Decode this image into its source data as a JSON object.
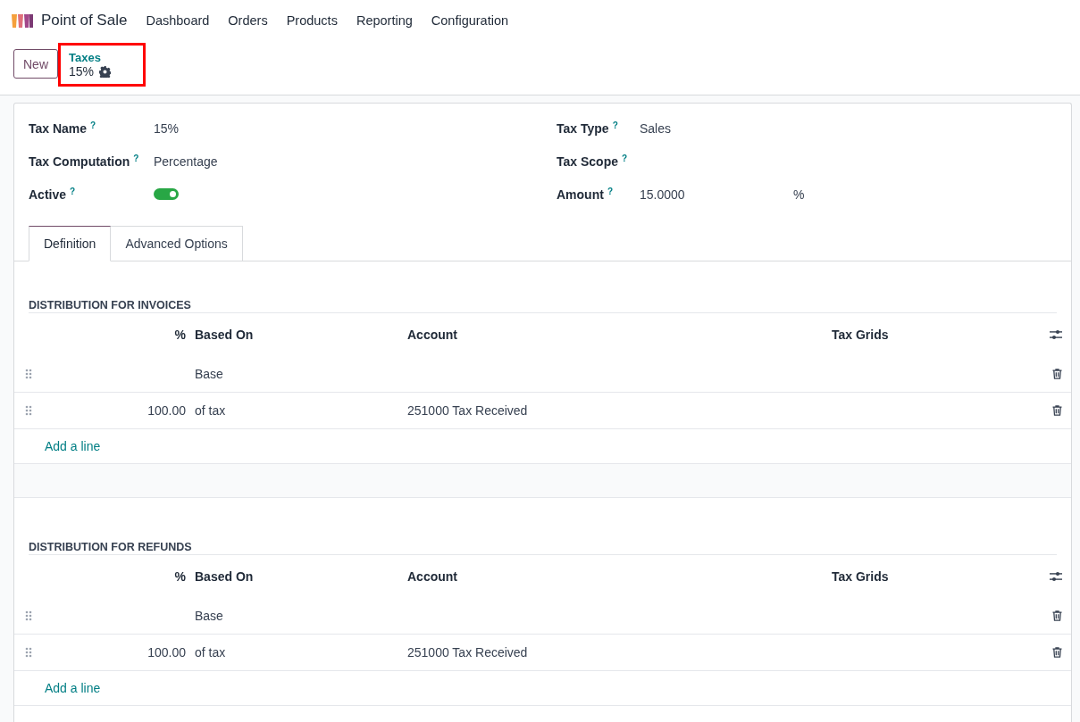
{
  "navbar": {
    "app_name": "Point of Sale",
    "menu": [
      "Dashboard",
      "Orders",
      "Products",
      "Reporting",
      "Configuration"
    ]
  },
  "control_panel": {
    "new_button": "New",
    "breadcrumb": "Taxes",
    "record_title": "15%",
    "highlighted": true
  },
  "fields_left": [
    {
      "label": "Tax Name",
      "help": "?",
      "kind": "text",
      "value": "15%"
    },
    {
      "label": "Tax Computation",
      "help": "?",
      "kind": "text",
      "value": "Percentage"
    },
    {
      "label": "Active",
      "help": "?",
      "kind": "toggle",
      "on": true
    }
  ],
  "fields_right": [
    {
      "label": "Tax Type",
      "help": "?",
      "kind": "text",
      "value": "Sales"
    },
    {
      "label": "Tax Scope",
      "help": "?",
      "kind": "text"
    },
    {
      "label": "Amount",
      "help": "?",
      "kind": "amount",
      "value": "15.0000",
      "unit": "%"
    }
  ],
  "tabs": [
    {
      "label": "Definition",
      "selected": true
    },
    {
      "label": "Advanced Options",
      "selected": false
    }
  ],
  "sections": [
    {
      "title": "DISTRIBUTION FOR INVOICES",
      "columns": [
        "%",
        "Based On",
        "Account",
        "Tax Grids"
      ],
      "rows": [
        {
          "percent": "",
          "based_on": "Base",
          "account": ""
        },
        {
          "percent": "100.00",
          "based_on": "of tax",
          "account": "251000 Tax Received"
        }
      ],
      "add_line": "Add a line"
    },
    {
      "title": "DISTRIBUTION FOR REFUNDS",
      "columns": [
        "%",
        "Based On",
        "Account",
        "Tax Grids"
      ],
      "rows": [
        {
          "percent": "",
          "based_on": "Base",
          "account": ""
        },
        {
          "percent": "100.00",
          "based_on": "of tax",
          "account": "251000 Tax Received"
        }
      ],
      "add_line": "Add a line"
    }
  ]
}
